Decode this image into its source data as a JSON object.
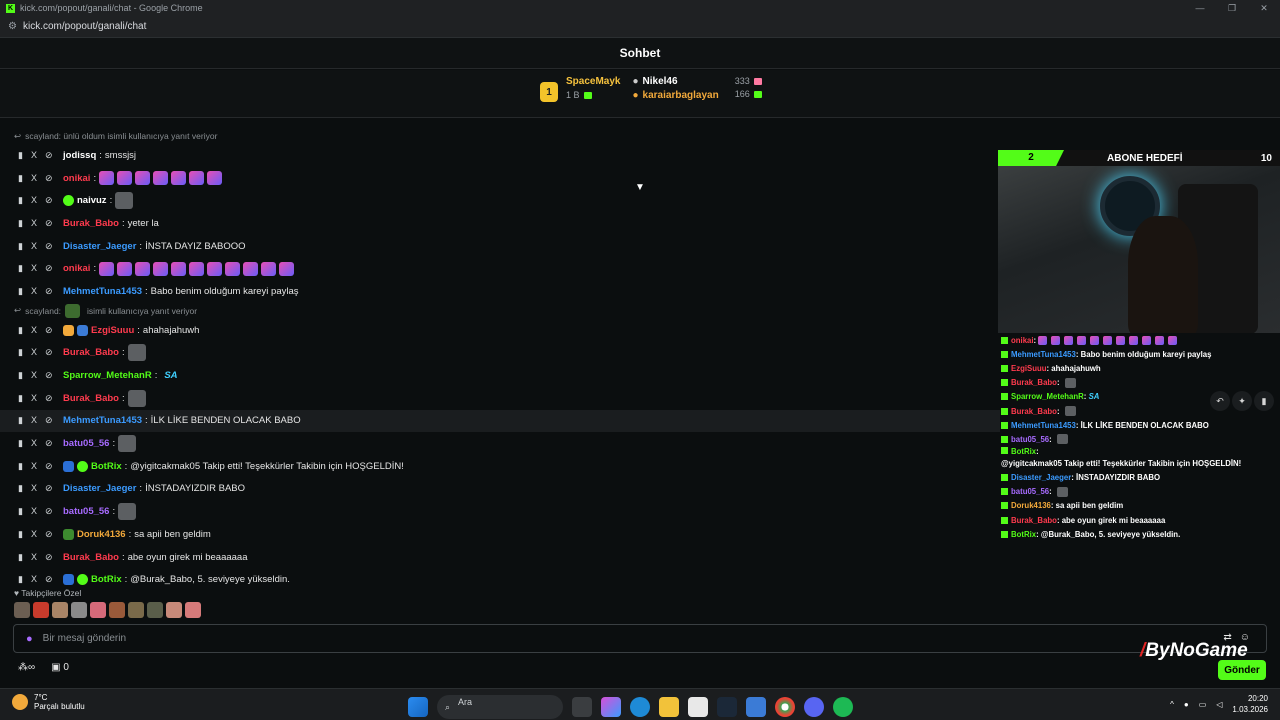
{
  "window": {
    "title": "kick.com/popout/ganali/chat - Google Chrome",
    "url": "kick.com/popout/ganali/chat",
    "controls": [
      "—",
      "❐",
      "✕"
    ]
  },
  "header": {
    "title": "Sohbet"
  },
  "leaderboard": {
    "rank": "1",
    "first": {
      "name": "SpaceMayk",
      "sub": "1 B"
    },
    "second": {
      "name": "Nikel46",
      "count": "333"
    },
    "third": {
      "name": "karaiarbaglayan",
      "count": "166"
    }
  },
  "chat": {
    "reply1": "scayland: ünlü oldum isimli kullanıcıya yanıt veriyor",
    "reply2": "scayland:",
    "reply2_tail": "isimli kullanıcıya yanıt veriyor",
    "messages": [
      {
        "user": "jodissq",
        "color": "#ffffff",
        "text": "smssjsj"
      },
      {
        "user": "onikai",
        "color": "#ff3b4e",
        "text": ""
      },
      {
        "user": "naivuz",
        "color": "#ffffff",
        "text": ""
      },
      {
        "user": "Burak_Babo",
        "color": "#ff3b4e",
        "text": "yeter la"
      },
      {
        "user": "Disaster_Jaeger",
        "color": "#3b9bff",
        "text": "İNSTA DAYIZ BABOOO"
      },
      {
        "user": "onikai",
        "color": "#ff3b4e",
        "text": ""
      },
      {
        "user": "MehmetTuna1453",
        "color": "#3b9bff",
        "text": "Babo benim olduğum kareyi paylaş"
      },
      {
        "user": "EzgiSuuu",
        "color": "#ff3b4e",
        "text": "ahahajahuwh"
      },
      {
        "user": "Burak_Babo",
        "color": "#ff3b4e",
        "text": ""
      },
      {
        "user": "Sparrow_MetehanR",
        "color": "#53fc18",
        "text": "SA"
      },
      {
        "user": "Burak_Babo",
        "color": "#ff3b4e",
        "text": ""
      },
      {
        "user": "MehmetTuna1453",
        "color": "#3b9bff",
        "text": "İLK LİKE BENDEN OLACAK BABO"
      },
      {
        "user": "batu05_56",
        "color": "#a76bff",
        "text": ""
      },
      {
        "user": "BotRix",
        "color": "#53fc18",
        "text": "@yigitcakmak05 Takip etti! Teşekkürler Takibin için HOŞGELDİN!"
      },
      {
        "user": "Disaster_Jaeger",
        "color": "#3b9bff",
        "text": "İNSTADAYIZDIR BABO"
      },
      {
        "user": "batu05_56",
        "color": "#a76bff",
        "text": ""
      },
      {
        "user": "Doruk4136",
        "color": "#f2a93b",
        "text": "sa apii ben geldim"
      },
      {
        "user": "Burak_Babo",
        "color": "#ff3b4e",
        "text": "abe oyun girek mi beaaaaaa"
      },
      {
        "user": "BotRix",
        "color": "#53fc18",
        "text": "@Burak_Babo, 5. seviyeye yükseldin."
      }
    ]
  },
  "followers_label": "Takipçilere Özel",
  "input": {
    "placeholder": "Bir mesaj gönderin"
  },
  "footer": {
    "count": "0"
  },
  "send_label": "Gönder",
  "overlay": {
    "goal_progress": "2",
    "goal_title": "ABONE HEDEFİ",
    "goal_target": "10",
    "messages": [
      {
        "user": "onikai",
        "color": "#ff3b4e",
        "text": ""
      },
      {
        "user": "MehmetTuna1453",
        "color": "#3b9bff",
        "text": "Babo benim olduğum kareyi paylaş"
      },
      {
        "user": "EzgiSuuu",
        "color": "#ff3b4e",
        "text": "ahahajahuwh"
      },
      {
        "user": "Burak_Babo",
        "color": "#ff3b4e",
        "text": ""
      },
      {
        "user": "Sparrow_MetehanR",
        "color": "#53fc18",
        "text": "SA"
      },
      {
        "user": "Burak_Babo",
        "color": "#ff3b4e",
        "text": ""
      },
      {
        "user": "MehmetTuna1453",
        "color": "#3b9bff",
        "text": "İLK LİKE BENDEN OLACAK BABO"
      },
      {
        "user": "batu05_56",
        "color": "#a76bff",
        "text": ""
      },
      {
        "user": "BotRix",
        "color": "#53fc18",
        "text": "@yigitcakmak05 Takip etti! Teşekkürler Takibin için HOŞGELDİN!"
      },
      {
        "user": "Disaster_Jaeger",
        "color": "#3b9bff",
        "text": "İNSTADAYIZDIR BABO"
      },
      {
        "user": "batu05_56",
        "color": "#a76bff",
        "text": ""
      },
      {
        "user": "Doruk4136",
        "color": "#f2a93b",
        "text": "sa apii ben geldim"
      },
      {
        "user": "Burak_Babo",
        "color": "#ff3b4e",
        "text": "abe oyun girek mi beaaaaaa"
      },
      {
        "user": "BotRix",
        "color": "#53fc18",
        "text": "@Burak_Babo, 5. seviyeye yükseldin."
      }
    ]
  },
  "watermark": {
    "text": "ByNoGame"
  },
  "taskbar": {
    "temp": "7°C",
    "weather": "Parçalı bulutlu",
    "search": "Ara",
    "time": "20:20",
    "date": "1.03.2026"
  },
  "colors": {
    "accent": "#53fc18",
    "bg": "#0b0e0f"
  }
}
